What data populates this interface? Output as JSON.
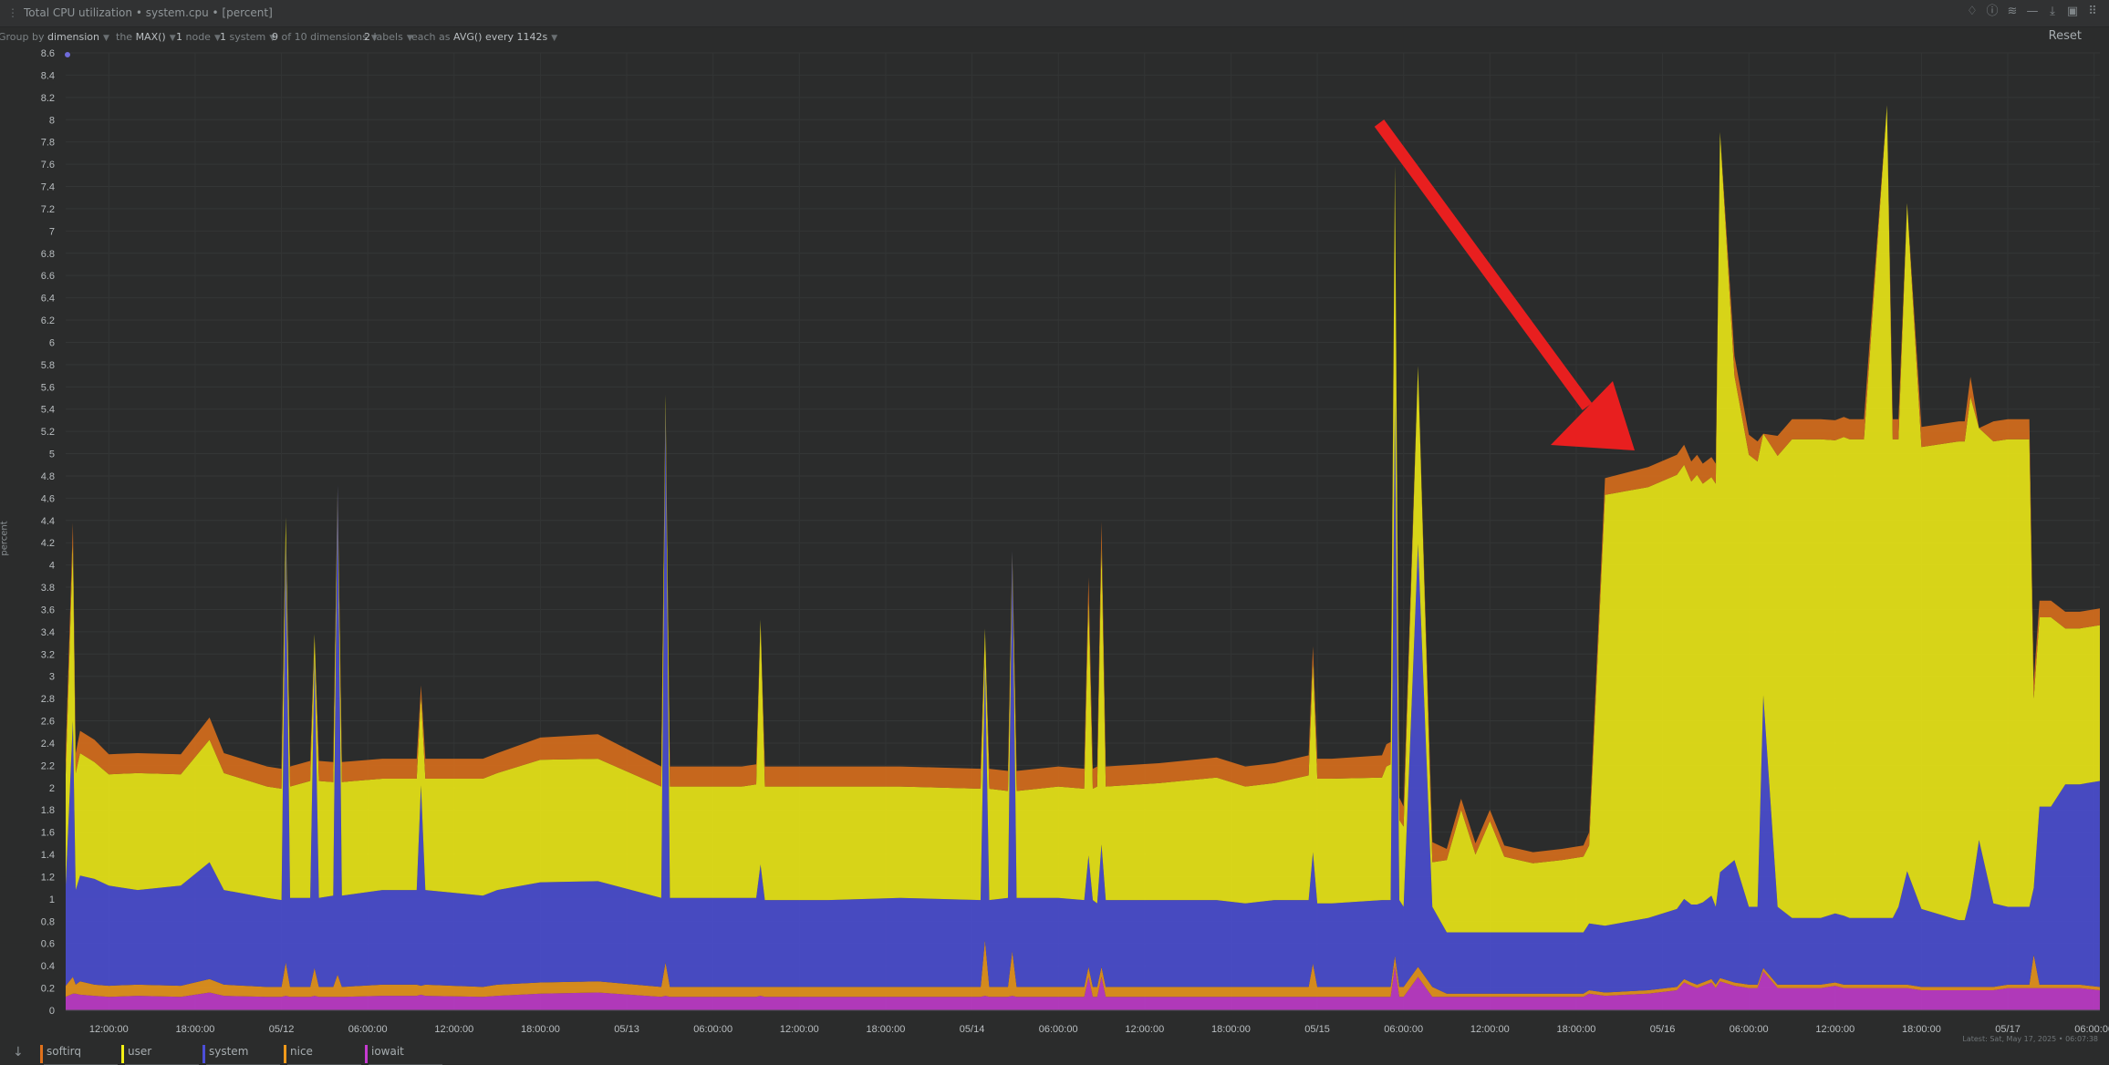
{
  "header": {
    "title": "Total CPU utilization • system.cpu • [percent]",
    "reset_label": "Reset"
  },
  "controls": [
    {
      "prefix": "Group by",
      "value": "dimension"
    },
    {
      "prefix": "the",
      "value": "MAX()"
    },
    {
      "prefix": "1",
      "value": "node"
    },
    {
      "prefix": "1",
      "value": "system"
    },
    {
      "prefix": "9",
      "value": "of 10 dimensions"
    },
    {
      "prefix": "2",
      "value": "labels"
    },
    {
      "prefix": "each as",
      "value": "AVG() every 1142s"
    }
  ],
  "footer": {
    "latest": "Latest: Sat, May 17, 2025 • 06:07:38"
  },
  "colors": {
    "softirq": "#e0711b",
    "user": "#f3f015",
    "system": "#4c4fd9",
    "nice": "#f09a1b",
    "iowait": "#c63bd1",
    "background": "#2b2c2c",
    "grid": "#353737",
    "annotation_arrow": "#e81f1f"
  },
  "chart_data": {
    "type": "area",
    "stacked": true,
    "ylabel": "percent",
    "ylim": [
      0,
      8.6
    ],
    "ytick_step": 0.2,
    "y_ticks": [
      "8.6",
      "8.4",
      "8.2",
      "8",
      "7.8",
      "7.6",
      "7.4",
      "7.2",
      "7",
      "6.8",
      "6.6",
      "6.4",
      "6.2",
      "6",
      "5.8",
      "5.6",
      "5.4",
      "5.2",
      "5",
      "4.8",
      "4.6",
      "4.4",
      "4.2",
      "4",
      "3.8",
      "3.6",
      "3.4",
      "3.2",
      "3",
      "2.8",
      "2.6",
      "2.4",
      "2.2",
      "2",
      "1.8",
      "1.6",
      "1.4",
      "1.2",
      "1",
      "0.8",
      "0.6",
      "0.4",
      "0.2",
      "0"
    ],
    "x_hours_range": [
      0,
      119
    ],
    "x_ticks": [
      {
        "t": 3,
        "label": "12:00:00"
      },
      {
        "t": 9,
        "label": "18:00:00"
      },
      {
        "t": 15,
        "label": "05/12"
      },
      {
        "t": 21,
        "label": "06:00:00"
      },
      {
        "t": 27,
        "label": "12:00:00"
      },
      {
        "t": 33,
        "label": "18:00:00"
      },
      {
        "t": 39,
        "label": "05/13"
      },
      {
        "t": 45,
        "label": "06:00:00"
      },
      {
        "t": 51,
        "label": "12:00:00"
      },
      {
        "t": 57,
        "label": "18:00:00"
      },
      {
        "t": 63,
        "label": "05/14"
      },
      {
        "t": 69,
        "label": "06:00:00"
      },
      {
        "t": 75,
        "label": "12:00:00"
      },
      {
        "t": 81,
        "label": "18:00:00"
      },
      {
        "t": 87,
        "label": "05/15"
      },
      {
        "t": 93,
        "label": "06:00:00"
      },
      {
        "t": 99,
        "label": "12:00:00"
      },
      {
        "t": 105,
        "label": "18:00:00"
      },
      {
        "t": 111,
        "label": "05/16"
      },
      {
        "t": 117,
        "label": "06:00:00"
      },
      {
        "t": 123,
        "label": "12:00:00"
      },
      {
        "t": 129,
        "label": "18:00:00"
      },
      {
        "t": 135,
        "label": "05/17"
      },
      {
        "t": 141,
        "label": "06:00:00"
      }
    ],
    "x_domain": [
      0,
      141.4
    ],
    "series": [
      {
        "name": "iowait",
        "color": "#c63bd1"
      },
      {
        "name": "nice",
        "color": "#f09a1b"
      },
      {
        "name": "system",
        "color": "#4c4fd9"
      },
      {
        "name": "user",
        "color": "#f3f015"
      },
      {
        "name": "softirq",
        "color": "#e0711b"
      }
    ],
    "points": {
      "t": [
        0,
        0.5,
        0.7,
        1.0,
        2,
        3,
        5,
        8,
        10,
        11,
        14,
        15.0,
        15.3,
        15.6,
        17,
        17.3,
        17.6,
        18.6,
        18.9,
        19.2,
        22,
        24.4,
        24.7,
        25.0,
        29,
        30,
        33,
        37,
        41.4,
        41.7,
        42.0,
        47,
        48.0,
        48.3,
        48.6,
        53,
        58,
        63.6,
        63.9,
        64.2,
        65.5,
        65.8,
        66.1,
        69,
        70.8,
        71.1,
        71.4,
        71.7,
        72.0,
        72.3,
        76,
        80,
        82,
        84,
        86.4,
        86.7,
        87.0,
        88,
        91.5,
        91.8,
        92.1,
        92.4,
        92.7,
        93.0,
        94,
        95,
        96,
        97,
        98,
        99,
        100,
        101,
        102,
        104,
        105.5,
        105.9,
        107,
        110,
        112,
        112.5,
        113,
        113.4,
        113.8,
        114.4,
        114.7,
        115.0,
        116,
        117,
        117.6,
        118,
        119,
        120,
        121,
        122,
        123,
        123.6,
        124,
        125,
        126.6,
        127.0,
        127.4,
        128,
        129,
        131.6,
        132.0,
        132.4,
        133,
        134,
        135,
        136.2,
        136.5,
        136.8,
        137.2,
        138,
        139,
        140,
        141.4
      ],
      "iowait": [
        0.12,
        0.15,
        0.15,
        0.14,
        0.13,
        0.12,
        0.13,
        0.12,
        0.16,
        0.13,
        0.12,
        0.12,
        0.13,
        0.12,
        0.12,
        0.13,
        0.12,
        0.12,
        0.12,
        0.12,
        0.13,
        0.13,
        0.14,
        0.13,
        0.12,
        0.13,
        0.15,
        0.16,
        0.12,
        0.13,
        0.12,
        0.12,
        0.12,
        0.13,
        0.12,
        0.12,
        0.12,
        0.12,
        0.13,
        0.12,
        0.12,
        0.13,
        0.12,
        0.12,
        0.12,
        0.3,
        0.12,
        0.12,
        0.3,
        0.12,
        0.12,
        0.12,
        0.12,
        0.12,
        0.12,
        0.12,
        0.12,
        0.12,
        0.12,
        0.12,
        0.12,
        0.4,
        0.12,
        0.12,
        0.3,
        0.12,
        0.12,
        0.12,
        0.12,
        0.12,
        0.12,
        0.12,
        0.12,
        0.12,
        0.12,
        0.15,
        0.13,
        0.15,
        0.18,
        0.25,
        0.22,
        0.2,
        0.22,
        0.25,
        0.2,
        0.26,
        0.22,
        0.2,
        0.2,
        0.35,
        0.2,
        0.2,
        0.2,
        0.2,
        0.22,
        0.2,
        0.2,
        0.2,
        0.2,
        0.2,
        0.2,
        0.2,
        0.18,
        0.18,
        0.18,
        0.18,
        0.18,
        0.18,
        0.2,
        0.2,
        0.2,
        0.2,
        0.2,
        0.2,
        0.2,
        0.2,
        0.18,
        0.18
      ],
      "nice": [
        0.1,
        0.15,
        0.08,
        0.12,
        0.1,
        0.1,
        0.1,
        0.1,
        0.12,
        0.1,
        0.09,
        0.09,
        0.3,
        0.09,
        0.09,
        0.25,
        0.09,
        0.09,
        0.2,
        0.09,
        0.1,
        0.1,
        0.08,
        0.1,
        0.09,
        0.1,
        0.1,
        0.1,
        0.09,
        0.3,
        0.09,
        0.09,
        0.09,
        0.08,
        0.09,
        0.09,
        0.09,
        0.09,
        0.5,
        0.09,
        0.09,
        0.4,
        0.09,
        0.09,
        0.09,
        0.09,
        0.09,
        0.09,
        0.09,
        0.09,
        0.09,
        0.09,
        0.09,
        0.09,
        0.09,
        0.3,
        0.09,
        0.09,
        0.09,
        0.09,
        0.09,
        0.09,
        0.09,
        0.09,
        0.09,
        0.09,
        0.03,
        0.03,
        0.03,
        0.03,
        0.03,
        0.03,
        0.03,
        0.03,
        0.03,
        0.03,
        0.03,
        0.03,
        0.03,
        0.03,
        0.03,
        0.03,
        0.03,
        0.03,
        0.03,
        0.03,
        0.03,
        0.03,
        0.03,
        0.03,
        0.03,
        0.03,
        0.03,
        0.03,
        0.03,
        0.03,
        0.03,
        0.03,
        0.03,
        0.03,
        0.03,
        0.03,
        0.03,
        0.03,
        0.03,
        0.03,
        0.03,
        0.03,
        0.03,
        0.03,
        0.03,
        0.3,
        0.03,
        0.03,
        0.03,
        0.03,
        0.03,
        0.03
      ],
      "system": [
        0.9,
        2.3,
        0.85,
        0.95,
        0.95,
        0.9,
        0.85,
        0.9,
        1.05,
        0.85,
        0.8,
        0.78,
        3.8,
        0.8,
        0.8,
        2.8,
        0.8,
        0.82,
        4.4,
        0.82,
        0.85,
        0.85,
        1.8,
        0.85,
        0.82,
        0.85,
        0.9,
        0.9,
        0.8,
        5.0,
        0.8,
        0.8,
        0.8,
        1.1,
        0.78,
        0.78,
        0.8,
        0.78,
        2.5,
        0.78,
        0.8,
        3.6,
        0.8,
        0.8,
        0.78,
        1.0,
        0.78,
        0.75,
        1.1,
        0.78,
        0.78,
        0.78,
        0.75,
        0.78,
        0.78,
        1.0,
        0.75,
        0.75,
        0.78,
        0.78,
        0.78,
        5.0,
        0.78,
        0.72,
        3.8,
        0.72,
        0.55,
        0.55,
        0.55,
        0.55,
        0.55,
        0.55,
        0.55,
        0.55,
        0.55,
        0.6,
        0.6,
        0.65,
        0.7,
        0.72,
        0.7,
        0.72,
        0.72,
        0.75,
        0.7,
        0.95,
        1.1,
        0.7,
        0.7,
        2.45,
        0.7,
        0.6,
        0.6,
        0.6,
        0.62,
        0.62,
        0.6,
        0.6,
        0.6,
        0.6,
        0.7,
        1.02,
        0.7,
        0.6,
        0.6,
        0.8,
        1.32,
        0.75,
        0.7,
        0.7,
        0.7,
        0.6,
        1.6,
        1.6,
        1.8,
        1.8,
        1.85,
        1.85
      ],
      "user": [
        1.0,
        1.6,
        1.05,
        1.1,
        1.05,
        1.0,
        1.05,
        1.0,
        1.1,
        1.05,
        1.0,
        1.0,
        0.2,
        1.0,
        1.05,
        0.2,
        1.05,
        1.02,
        0.0,
        1.02,
        1.0,
        1.0,
        0.8,
        1.0,
        1.05,
        1.05,
        1.1,
        1.1,
        1.0,
        0.1,
        1.0,
        1.0,
        1.02,
        2.2,
        1.02,
        1.02,
        1.0,
        1.0,
        0.3,
        1.0,
        0.96,
        0.0,
        0.96,
        1.0,
        1.0,
        2.3,
        1.0,
        1.05,
        2.7,
        1.02,
        1.05,
        1.1,
        1.05,
        1.05,
        1.12,
        1.7,
        1.12,
        1.12,
        1.1,
        1.2,
        1.22,
        2.1,
        0.72,
        0.72,
        1.6,
        0.4,
        0.65,
        1.1,
        0.7,
        1.0,
        0.68,
        0.65,
        0.62,
        0.65,
        0.68,
        0.7,
        3.87,
        3.87,
        3.9,
        3.9,
        3.8,
        3.86,
        3.76,
        3.76,
        3.8,
        6.65,
        4.35,
        4.06,
        4.0,
        2.35,
        4.05,
        4.3,
        4.3,
        4.3,
        4.25,
        4.3,
        4.3,
        4.3,
        7.3,
        4.3,
        4.2,
        6.0,
        4.15,
        4.3,
        4.3,
        4.5,
        3.7,
        4.15,
        4.2,
        4.2,
        4.2,
        1.7,
        1.7,
        1.7,
        1.4,
        1.4,
        1.4,
        1.4
      ],
      "softirq": [
        0.18,
        0.18,
        0.18,
        0.2,
        0.2,
        0.18,
        0.18,
        0.18,
        0.2,
        0.18,
        0.18,
        0.18,
        0.0,
        0.18,
        0.18,
        0.0,
        0.18,
        0.18,
        0.0,
        0.18,
        0.18,
        0.18,
        0.1,
        0.18,
        0.18,
        0.18,
        0.2,
        0.22,
        0.18,
        0.0,
        0.18,
        0.18,
        0.18,
        0.0,
        0.18,
        0.18,
        0.18,
        0.18,
        0.0,
        0.18,
        0.18,
        0.0,
        0.18,
        0.18,
        0.18,
        0.2,
        0.18,
        0.18,
        0.2,
        0.18,
        0.18,
        0.18,
        0.18,
        0.18,
        0.18,
        0.15,
        0.18,
        0.18,
        0.2,
        0.2,
        0.2,
        0.0,
        0.2,
        0.18,
        0.0,
        0.18,
        0.1,
        0.1,
        0.1,
        0.1,
        0.1,
        0.1,
        0.1,
        0.1,
        0.1,
        0.12,
        0.15,
        0.18,
        0.18,
        0.18,
        0.18,
        0.18,
        0.18,
        0.18,
        0.18,
        0.0,
        0.18,
        0.18,
        0.18,
        0.0,
        0.18,
        0.18,
        0.18,
        0.18,
        0.18,
        0.18,
        0.18,
        0.18,
        0.0,
        0.18,
        0.18,
        0.0,
        0.18,
        0.18,
        0.18,
        0.18,
        0.0,
        0.18,
        0.18,
        0.18,
        0.18,
        0.15,
        0.15,
        0.15,
        0.15,
        0.15,
        0.15,
        0.15
      ]
    },
    "legend": [
      "softirq",
      "user",
      "system",
      "nice",
      "iowait"
    ]
  }
}
